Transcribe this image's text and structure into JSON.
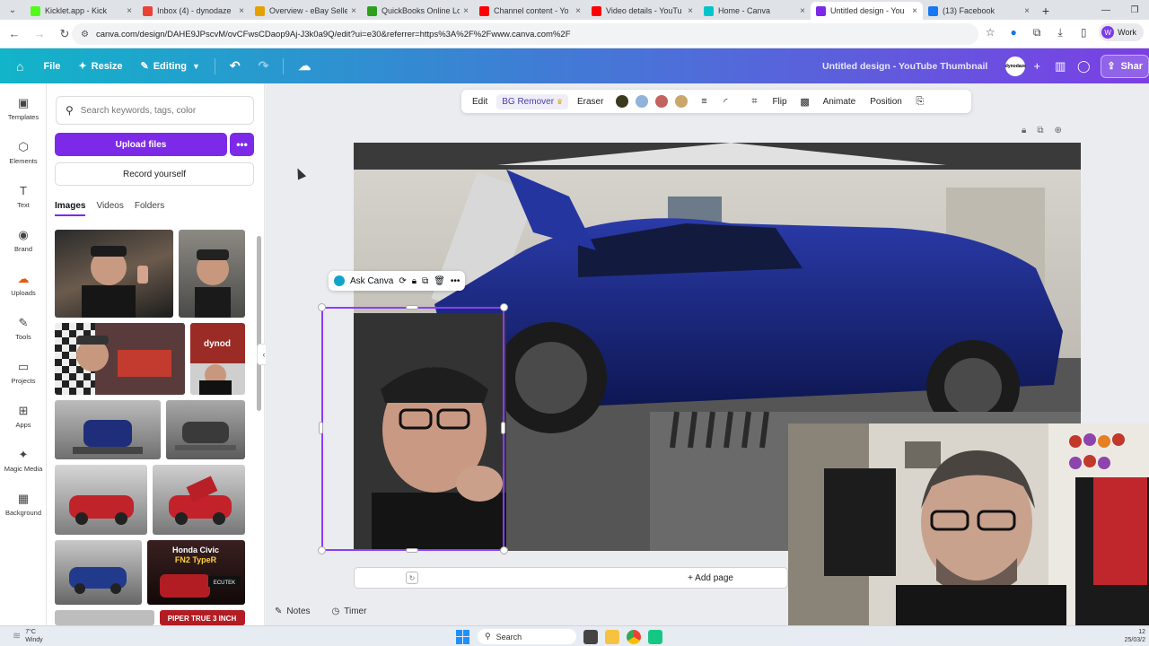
{
  "browser": {
    "tabs": [
      {
        "title": "Kicklet.app - Kick",
        "color": "#53fc18"
      },
      {
        "title": "Inbox (4) - dynodaze",
        "color": "#ea4335"
      },
      {
        "title": "Overview - eBay Seller",
        "color": "#e5a100"
      },
      {
        "title": "QuickBooks Online Lo",
        "color": "#2ca01c"
      },
      {
        "title": "Channel content - Yo",
        "color": "#ff0000"
      },
      {
        "title": "Video details - YouTu",
        "color": "#ff0000"
      },
      {
        "title": "Home - Canva",
        "color": "#00c4cc"
      },
      {
        "title": "Untitled design - You",
        "color": "#7d2ae8"
      },
      {
        "title": "(13) Facebook",
        "color": "#1877f2"
      }
    ],
    "active_tab_index": 7,
    "url": "canva.com/design/DAHE9JPscvM/ovCFwsCDaop9Aj-J3k0a9Q/edit?ui=e30&referrer=https%3A%2F%2Fwww.canva.com%2F",
    "profile_label": "Work",
    "profile_initial": "W"
  },
  "canva_header": {
    "file": "File",
    "resize": "Resize",
    "editing": "Editing",
    "design_title": "Untitled design - YouTube Thumbnail",
    "share": "Shar",
    "avatar_text": "dynodaze"
  },
  "rail": [
    {
      "label": "Templates",
      "icon": "templates-icon",
      "glyph": "▣"
    },
    {
      "label": "Elements",
      "icon": "elements-icon",
      "glyph": "⬡"
    },
    {
      "label": "Text",
      "icon": "text-icon",
      "glyph": "T"
    },
    {
      "label": "Brand",
      "icon": "brand-icon",
      "glyph": "◉"
    },
    {
      "label": "Uploads",
      "icon": "uploads-icon",
      "glyph": "☁"
    },
    {
      "label": "Tools",
      "icon": "tools-icon",
      "glyph": "✎"
    },
    {
      "label": "Projects",
      "icon": "projects-icon",
      "glyph": "▭"
    },
    {
      "label": "Apps",
      "icon": "apps-icon",
      "glyph": "⊞"
    },
    {
      "label": "Magic Media",
      "icon": "magic-media-icon",
      "glyph": "✦"
    },
    {
      "label": "Background",
      "icon": "background-icon",
      "glyph": "▦"
    }
  ],
  "panel": {
    "search_placeholder": "Search keywords, tags, color",
    "upload_files": "Upload files",
    "record_yourself": "Record yourself",
    "tabs": [
      "Images",
      "Videos",
      "Folders"
    ],
    "active_tab": "Images"
  },
  "context_toolbar": {
    "edit": "Edit",
    "bg_remover": "BG Remover",
    "eraser": "Eraser",
    "swatches": [
      "#3b3a1f",
      "#8fb3d9",
      "#c2645e",
      "#c9a66b"
    ],
    "flip": "Flip",
    "animate": "Animate",
    "position": "Position"
  },
  "element_toolbar": {
    "ask_canva": "Ask Canva"
  },
  "workspace": {
    "add_page": "+ Add page",
    "notes": "Notes",
    "timer": "Timer"
  },
  "taskbar": {
    "temperature": "7°C",
    "weather": "Windy",
    "search": "Search",
    "time": "12",
    "date": "25/03/2"
  },
  "colors": {
    "accent": "#7d2ae8",
    "header_start": "#12b4c9",
    "header_end": "#7b3fe4"
  }
}
